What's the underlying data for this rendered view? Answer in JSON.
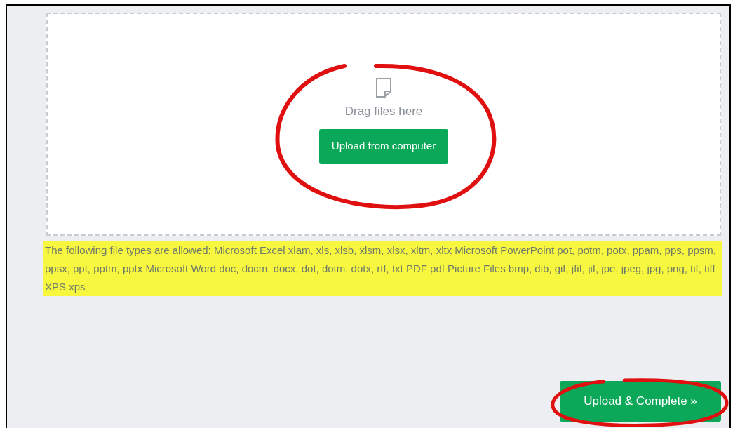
{
  "dropzone": {
    "prompt": "Drag files here",
    "button": "Upload from computer",
    "annotated": true
  },
  "allowed_types": {
    "text": "The following file types are allowed: Microsoft Excel xlam, xls, xlsb, xlsm, xlsx, xltm, xltx Microsoft PowerPoint pot, potm, potx, ppam, pps, ppsm, ppsx, ppt, pptm, pptx Microsoft Word doc, docm, docx, dot, dotm, dotx, rtf, txt PDF pdf Picture Files bmp, dib, gif, jfif, jif, jpe, jpeg, jpg, png, tif, tiff XPS xps",
    "highlighted": true
  },
  "footer": {
    "button": "Upload & Complete »",
    "annotated": true
  }
}
